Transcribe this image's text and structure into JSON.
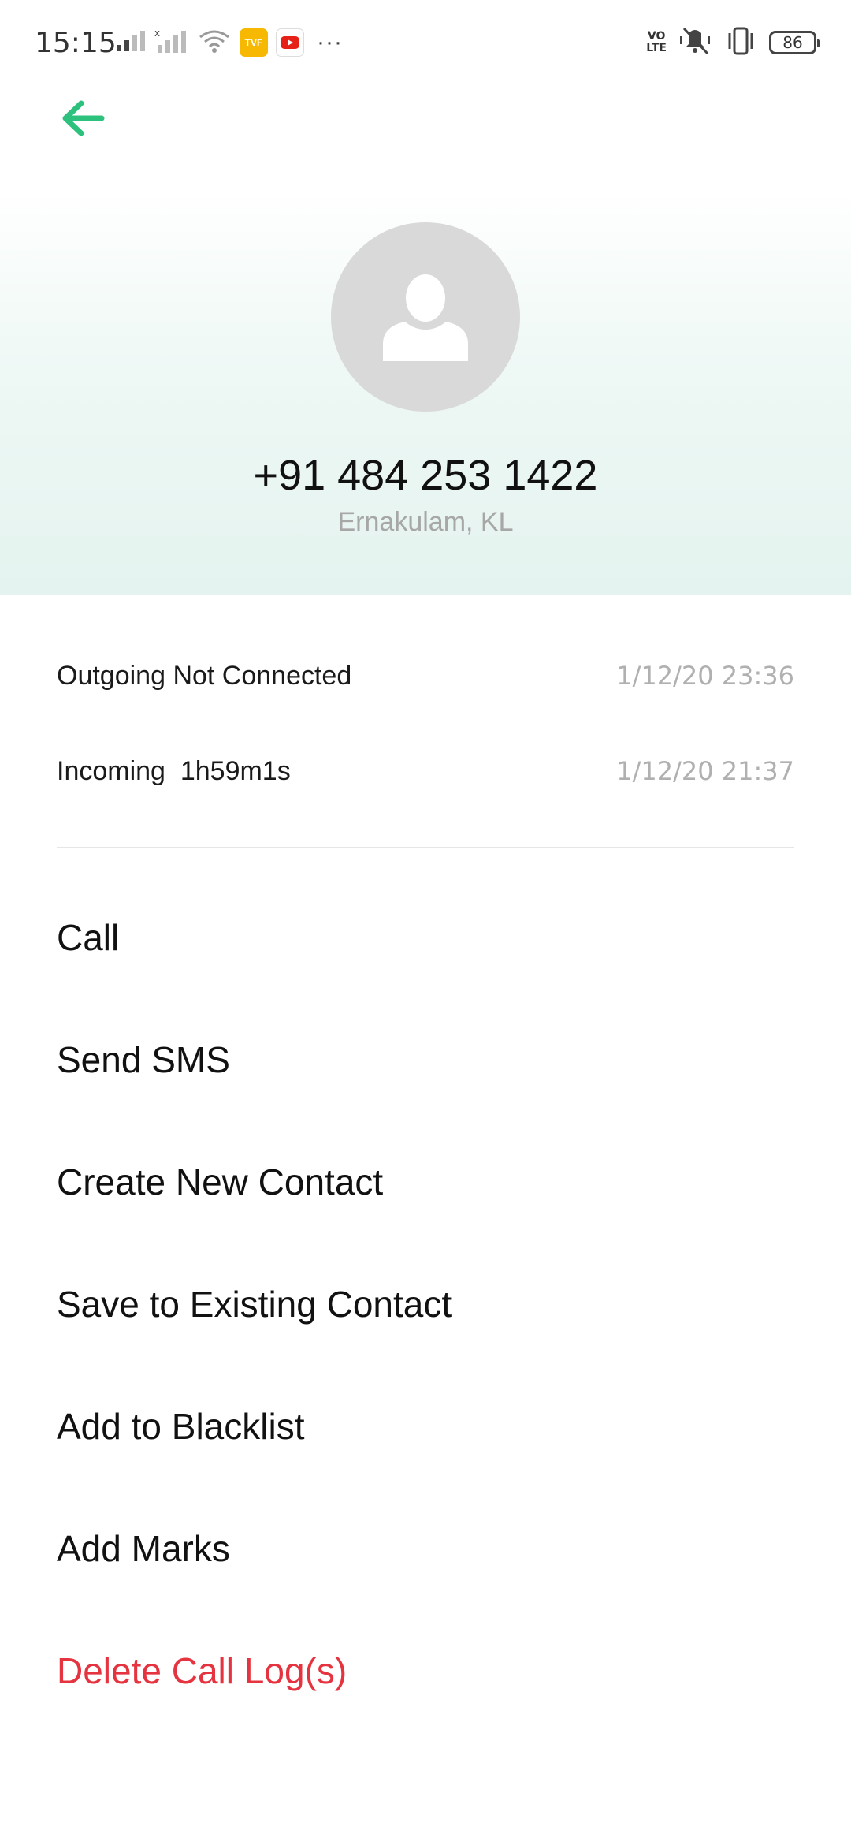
{
  "status_bar": {
    "time": "15:15",
    "app_badges": [
      "TVF",
      "YouTube"
    ],
    "more": "···",
    "volte_top": "VO",
    "volte_bottom": "LTE",
    "battery": "86",
    "icons": [
      "signal-icon",
      "signal-no-service-icon",
      "wifi-icon",
      "vibrate-muted-icon",
      "vibrate-icon",
      "battery-icon"
    ]
  },
  "header": {
    "phone_number": "+91 484 253 1422",
    "location": "Ernakulam, KL"
  },
  "call_log": [
    {
      "type": "Outgoing Not Connected",
      "time": "1/12/20 23:36"
    },
    {
      "type": "Incoming  1h59m1s",
      "time": "1/12/20 21:37"
    }
  ],
  "actions": [
    {
      "label": "Call"
    },
    {
      "label": "Send SMS"
    },
    {
      "label": "Create New Contact"
    },
    {
      "label": "Save to Existing Contact"
    },
    {
      "label": "Add to Blacklist"
    },
    {
      "label": "Add Marks"
    },
    {
      "label": "Delete Call Log(s)"
    }
  ],
  "colors": {
    "accent": "#2cc27e",
    "danger": "#e5333f",
    "avatar_bg": "#d9d9d9",
    "secondary_text": "#a7a7a7"
  }
}
